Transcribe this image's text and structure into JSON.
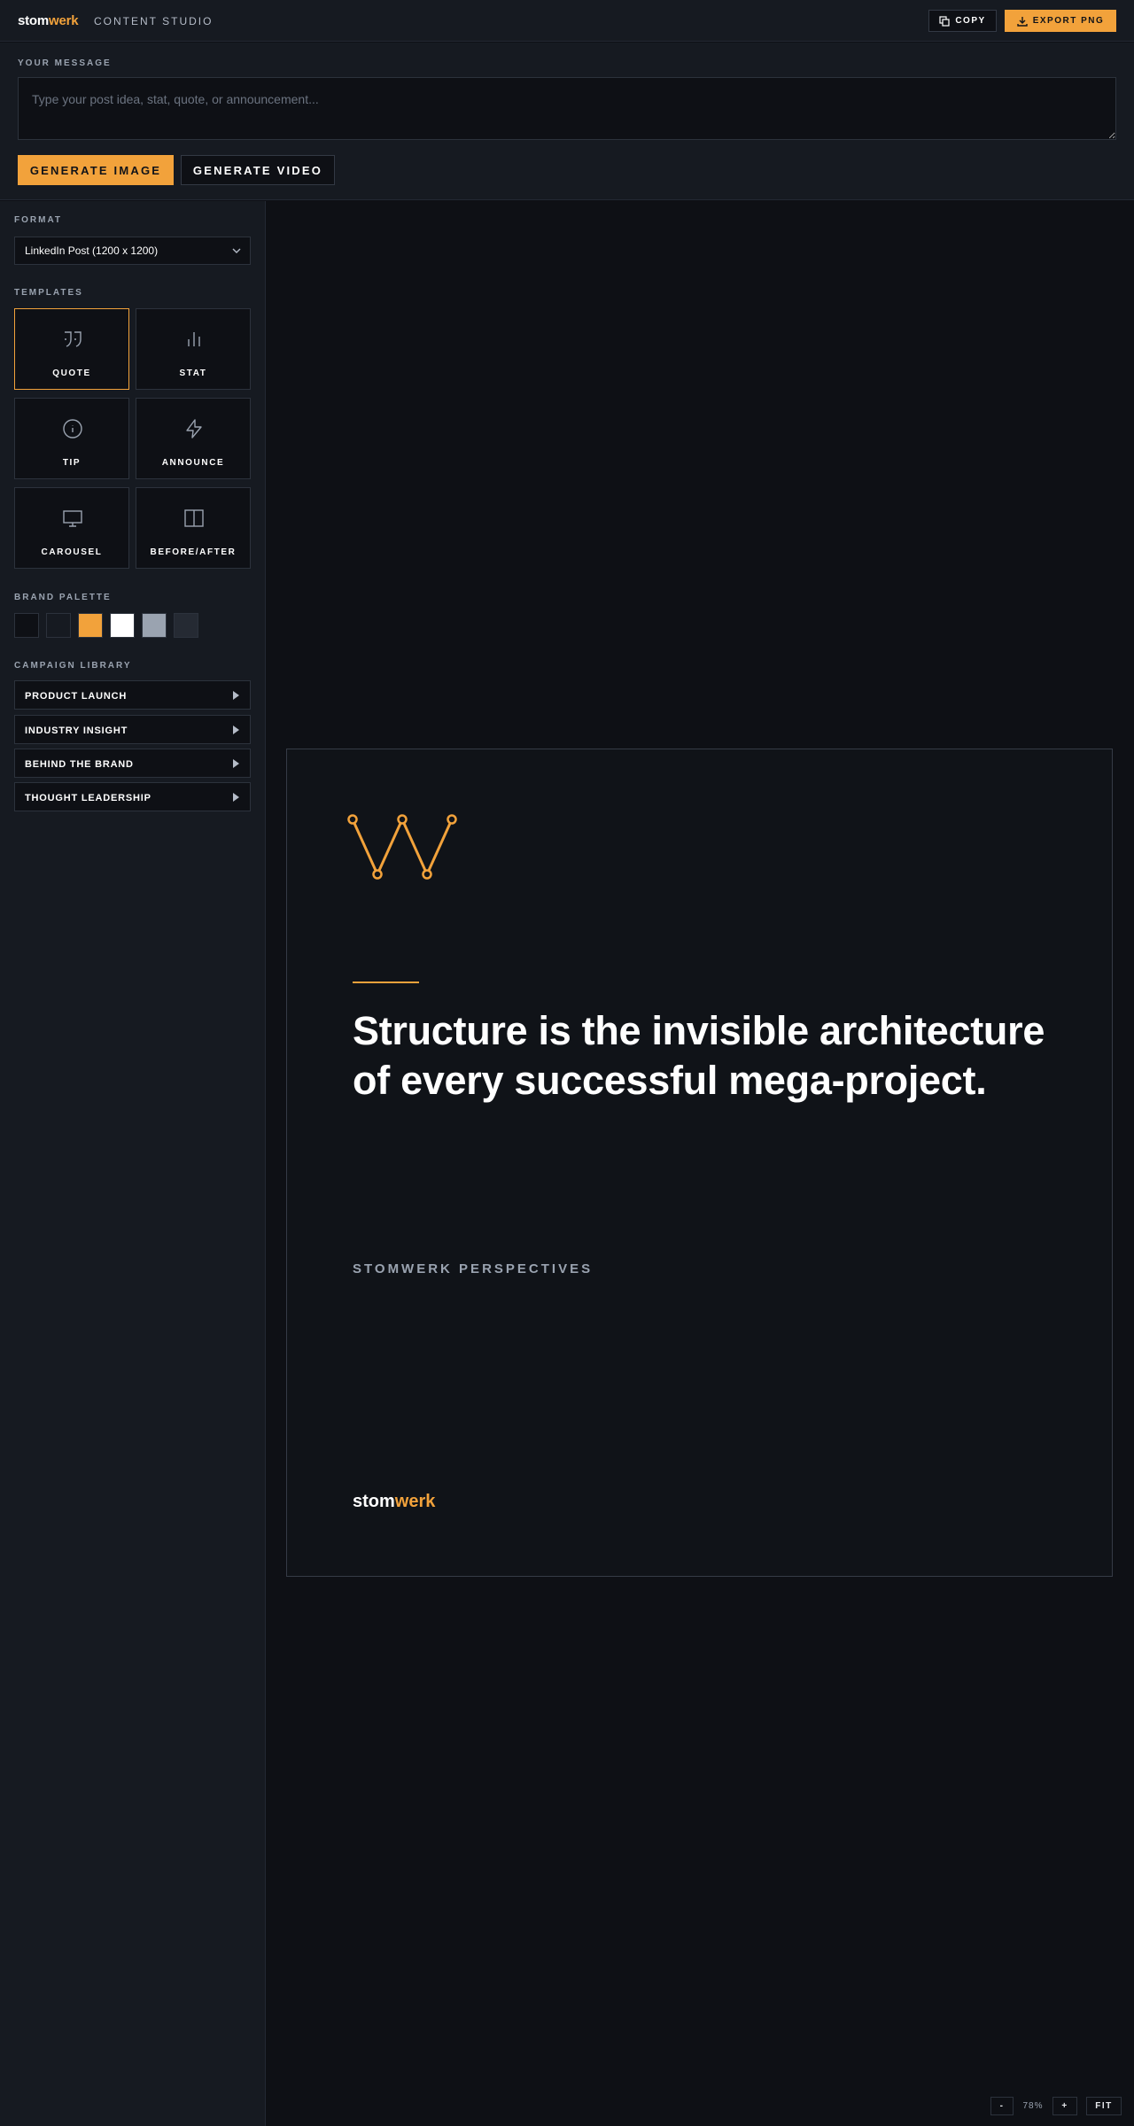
{
  "header": {
    "brand_part1": "stom",
    "brand_part2": "werk",
    "app_title": "CONTENT STUDIO",
    "copy_label": "COPY",
    "export_label": "EXPORT PNG"
  },
  "message": {
    "label": "YOUR MESSAGE",
    "value": "",
    "placeholder": "Type your post idea, stat, quote, or announcement...",
    "generate_image_label": "GENERATE IMAGE",
    "generate_video_label": "GENERATE VIDEO"
  },
  "sidebar": {
    "format_label": "FORMAT",
    "format_value": "LinkedIn Post (1200 x 1200)",
    "templates_label": "TEMPLATES",
    "templates": [
      {
        "name": "QUOTE",
        "icon": "quote-icon",
        "active": true
      },
      {
        "name": "STAT",
        "icon": "bar-chart-icon",
        "active": false
      },
      {
        "name": "TIP",
        "icon": "info-icon",
        "active": false
      },
      {
        "name": "ANNOUNCE",
        "icon": "lightning-icon",
        "active": false
      },
      {
        "name": "CAROUSEL",
        "icon": "monitor-icon",
        "active": false
      },
      {
        "name": "BEFORE/AFTER",
        "icon": "split-icon",
        "active": false
      }
    ],
    "palette_label": "BRAND PALETTE",
    "palette": [
      "#0e1015",
      "#161a21",
      "#f2a23b",
      "#ffffff",
      "#9aa3b0",
      "#252a33"
    ],
    "campaign_label": "CAMPAIGN LIBRARY",
    "campaigns": [
      "PRODUCT LAUNCH",
      "INDUSTRY INSIGHT",
      "BEHIND THE BRAND",
      "THOUGHT LEADERSHIP"
    ]
  },
  "post": {
    "quote": "Structure is the invisible architecture of every successful mega-project.",
    "series": "STOMWERK PERSPECTIVES",
    "brand_part1": "stom",
    "brand_part2": "werk",
    "accent_color": "#f2a23b"
  },
  "zoom": {
    "minus_label": "-",
    "level": "78%",
    "plus_label": "+",
    "fit_label": "FIT"
  }
}
